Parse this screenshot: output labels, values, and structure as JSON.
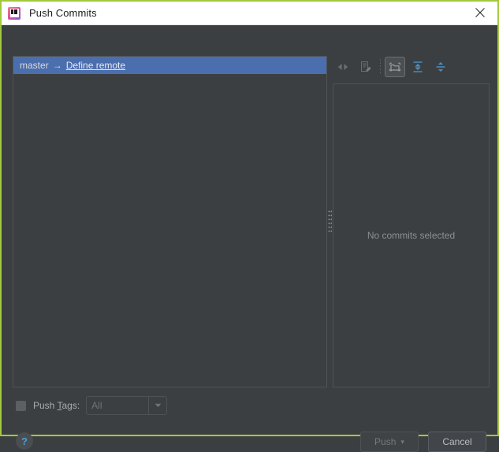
{
  "window": {
    "title": "Push Commits",
    "app_icon": "intellij-idea-icon",
    "close_label": "✕",
    "border_color": "#a2c93a",
    "titlebar_bg": "#ffffff",
    "panel_bg": "#3c3f41",
    "selection_color": "#4b6eaf",
    "link_color": "#e8eaec",
    "accent_help": "#4a9fd8"
  },
  "toolbar": {
    "buttons": [
      {
        "name": "collapse-changes-icon",
        "tooltip": "Group by directory",
        "enabled": false,
        "active": false
      },
      {
        "name": "edit-annotate-icon",
        "tooltip": "Show diff preview",
        "enabled": false,
        "active": false
      },
      {
        "name": "group-by-directory-icon",
        "tooltip": "Group by directory",
        "enabled": true,
        "active": true
      },
      {
        "name": "expand-all-icon",
        "tooltip": "Expand All",
        "enabled": true,
        "active": false
      },
      {
        "name": "collapse-all-icon",
        "tooltip": "Collapse All",
        "enabled": true,
        "active": false
      }
    ]
  },
  "commit_list": {
    "rows": [
      {
        "branch": "master",
        "arrow": "→",
        "remote_link": "Define remote",
        "selected": true
      }
    ]
  },
  "details_panel": {
    "empty_message": "No commits selected"
  },
  "push_tags": {
    "checkbox_checked": false,
    "label_prefix": "Push ",
    "label_mnemonic": "T",
    "label_suffix": "ags:",
    "dropdown_value": "All",
    "dropdown_caret": "▼",
    "enabled": false
  },
  "footer": {
    "help_label": "?",
    "push_label": "Push",
    "push_caret": "▾",
    "push_enabled": false,
    "cancel_label": "Cancel",
    "cancel_enabled": true
  }
}
